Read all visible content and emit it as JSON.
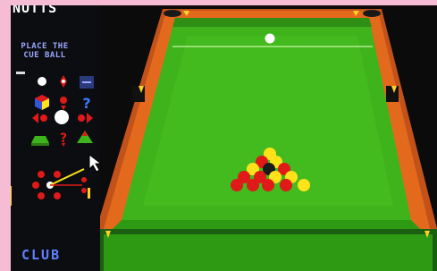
{
  "game": {
    "player_name": "NUTTS",
    "message_line1": "PLACE THE",
    "message_line2": "CUE BALL",
    "club_label": "CLUB"
  },
  "colors": {
    "felt": "#3fb31b",
    "cushion": "#e36a1c",
    "red_ball": "#e01919",
    "yellow_ball": "#ffe21a",
    "background_pink": "#f6bcd4"
  },
  "icons": [
    "cue-ball-icon",
    "cue-tip-icon",
    "menu-icon",
    "cube-icon",
    "rotate-icon",
    "help-icon",
    "move-left-icon",
    "spin-ball-icon",
    "move-right-icon",
    "table-flat-icon",
    "help-small-icon",
    "table-tilt-icon",
    "aim-control-icon"
  ]
}
